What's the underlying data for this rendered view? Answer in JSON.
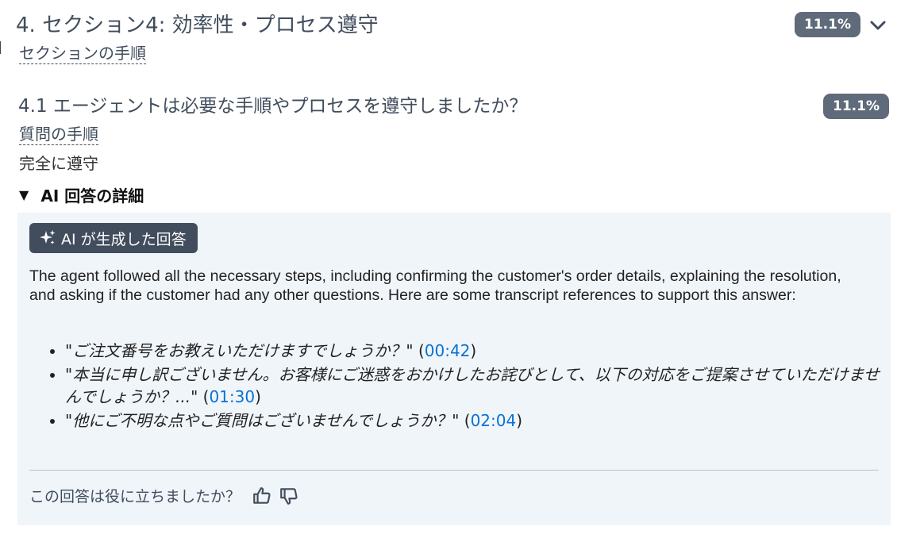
{
  "section": {
    "title": "4. セクション4: 効率性・プロセス遵守",
    "score_badge": "11.1%",
    "procedure_link": "セクションの手順"
  },
  "question": {
    "title": "4.1 エージェントは必要な手順やプロセスを遵守しましたか？",
    "score_badge": "11.1%",
    "procedure_link": "質問の手順",
    "answer": "完全に遵守"
  },
  "ai_details": {
    "toggle_label": "AI 回答の詳細",
    "chip_label": "AI が生成した回答",
    "explanation": "The agent followed all the necessary steps, including confirming the customer's order details, explaining the resolution, and asking if the customer had any other questions. Here are some transcript references to support this answer:",
    "references": [
      {
        "quote": "ご注文番号をお教えいただけますでしょうか？",
        "timestamp": "00:42"
      },
      {
        "quote": "本当に申し訳ございません。お客様にご迷惑をおかけしたお詫びとして、以下の対応をご提案させていただけませんでしょうか？...",
        "timestamp": "01:30"
      },
      {
        "quote": "他にご不明な点やご質問はございませんでしょうか？",
        "timestamp": "02:04"
      }
    ],
    "feedback_question": "この回答は役に立ちましたか？"
  },
  "icons": {
    "chevron": "chevron-down-icon",
    "caret": "caret-down-icon",
    "sparkle": "sparkle-icon",
    "thumbs_up": "thumbs-up-icon",
    "thumbs_down": "thumbs-down-icon"
  },
  "colors": {
    "badge_bg": "#5f6b7a",
    "chip_bg": "#414d5c",
    "panel_bg": "#f0f5fa",
    "link": "#0972d3"
  }
}
